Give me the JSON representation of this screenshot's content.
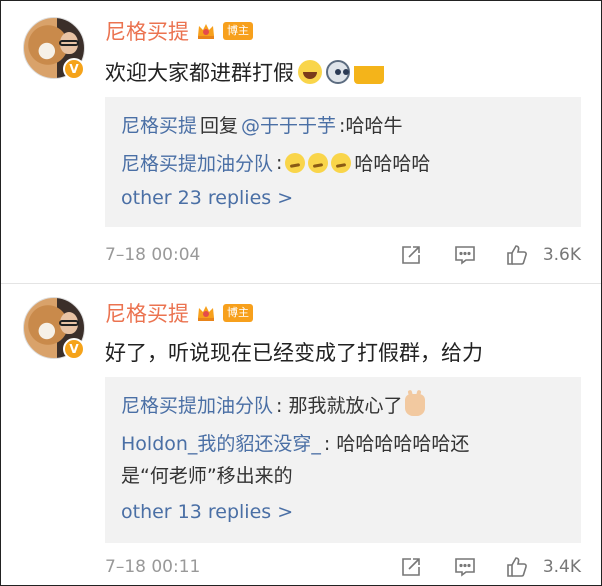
{
  "comments": [
    {
      "username": "尼格买提",
      "badge": "博主",
      "verified": "V",
      "text": "欢迎大家都进群打假",
      "emojis": [
        "laughing-crying-emoji",
        "husky-emoji",
        "beer-cheers-emoji"
      ],
      "replies": [
        {
          "user": "尼格买提",
          "pre": "回复",
          "mention": "@于于于芋",
          "after": ":哈哈牛"
        },
        {
          "user": "尼格买提加油分队",
          "pre": ":",
          "emojis": [
            "thinking-emoji",
            "thinking-emoji",
            "thinking-emoji"
          ],
          "after": "哈哈哈哈"
        }
      ],
      "more_replies": "other 23 replies >",
      "time": "7–18 00:04",
      "likes": "3.6K"
    },
    {
      "username": "尼格买提",
      "badge": "博主",
      "verified": "V",
      "text": "好了，听说现在已经变成了打假群，给力",
      "replies": [
        {
          "user": "尼格买提加油分队",
          "after": ": 那我就放心了",
          "emojis": [
            "victory-hand-emoji"
          ]
        },
        {
          "user": "Holdon_我的貂还没穿_",
          "after": ": 哈哈哈哈哈哈还",
          "line2": "是“何老师”移出来的"
        }
      ],
      "more_replies": "other 13 replies >",
      "time": "7–18 00:11",
      "likes": "3.4K"
    }
  ],
  "colors": {
    "username": "#eb7350",
    "link": "#4a6fa5",
    "badge": "#f7a01c",
    "reply_bg": "#f2f2f2",
    "meta": "#999999"
  }
}
